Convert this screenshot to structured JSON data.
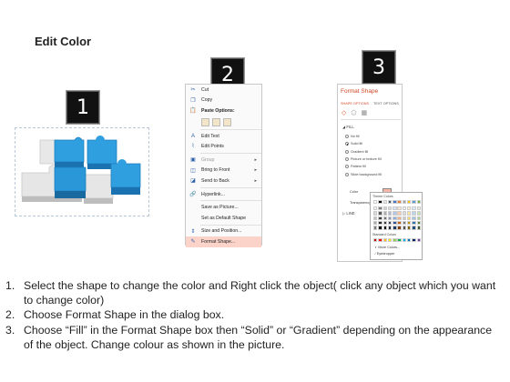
{
  "page": {
    "title": "Edit Color"
  },
  "badges": [
    "1",
    "2",
    "3"
  ],
  "context_menu": {
    "items_top": [
      {
        "label": "Cut",
        "icon": "scissors-icon",
        "glyph": "✂"
      },
      {
        "label": "Copy",
        "icon": "copy-icon",
        "glyph": "❐"
      },
      {
        "label": "Paste Options:",
        "icon": "paste-icon",
        "glyph": "📋"
      }
    ],
    "items": [
      {
        "label": "Edit Text",
        "icon": "edit-text-icon",
        "glyph": "A",
        "dim": false,
        "submenu": false
      },
      {
        "label": "Edit Points",
        "icon": "edit-points-icon",
        "glyph": "⌇",
        "dim": false,
        "submenu": false
      },
      {
        "label": "Group",
        "icon": "group-icon",
        "glyph": "▣",
        "dim": true,
        "submenu": true
      },
      {
        "label": "Bring to Front",
        "icon": "bring-front-icon",
        "glyph": "◫",
        "dim": false,
        "submenu": true
      },
      {
        "label": "Send to Back",
        "icon": "send-back-icon",
        "glyph": "◪",
        "dim": false,
        "submenu": true
      },
      {
        "label": "Hyperlink...",
        "icon": "hyperlink-icon",
        "glyph": "🔗",
        "dim": false,
        "submenu": false
      },
      {
        "label": "Save as Picture...",
        "icon": "",
        "glyph": "",
        "dim": false,
        "submenu": false
      },
      {
        "label": "Set as Default Shape",
        "icon": "",
        "glyph": "",
        "dim": false,
        "submenu": false
      },
      {
        "label": "Size and Position...",
        "icon": "size-position-icon",
        "glyph": "⇕",
        "dim": false,
        "submenu": false
      },
      {
        "label": "Format Shape...",
        "icon": "format-shape-icon",
        "glyph": "✎",
        "dim": false,
        "submenu": false,
        "highlight": true
      }
    ]
  },
  "format_pane": {
    "title": "Format Shape",
    "tabs": [
      "SHAPE OPTIONS",
      "TEXT OPTIONS"
    ],
    "fill_header": "◢ FILL",
    "fill_options": [
      {
        "label": "No fill",
        "selected": false
      },
      {
        "label": "Solid fill",
        "selected": true
      },
      {
        "label": "Gradient fill",
        "selected": false
      },
      {
        "label": "Picture or texture fill",
        "selected": false
      },
      {
        "label": "Pattern fill",
        "selected": false
      },
      {
        "label": "Slide background fill",
        "selected": false
      }
    ],
    "color_label": "Color",
    "transparency_label": "Transparency",
    "line_header": "▷ LINE"
  },
  "color_picker": {
    "theme_label": "Theme Colors",
    "standard_label": "Standard Colors",
    "more_colors": "More Colors...",
    "eyedropper": "Eyedropper",
    "theme_top": [
      "#ffffff",
      "#000000",
      "#e7e6e6",
      "#44546a",
      "#4472c4",
      "#ed7d31",
      "#a5a5a5",
      "#ffc000",
      "#5b9bd5",
      "#70ad47"
    ],
    "theme_shades": [
      "#f2f2f2",
      "#7f7f7f",
      "#d0cece",
      "#d6dce4",
      "#d9e2f3",
      "#fbe5d5",
      "#ededed",
      "#fff2cc",
      "#deebf6",
      "#e2efd9"
    ],
    "theme_shades2": [
      "#d8d8d8",
      "#595959",
      "#aeabab",
      "#adb9ca",
      "#b4c6e7",
      "#f7cbac",
      "#dbdbdb",
      "#fee599",
      "#bdd7ee",
      "#c5e0b3"
    ],
    "theme_shades3": [
      "#bfbfbf",
      "#3f3f3f",
      "#757070",
      "#8496b0",
      "#8eaadb",
      "#f4b183",
      "#c9c9c9",
      "#ffd965",
      "#9cc3e5",
      "#a8d08d"
    ],
    "theme_shades4": [
      "#a5a5a5",
      "#262626",
      "#3a3838",
      "#323f4f",
      "#2f5496",
      "#c55a11",
      "#7b7b7b",
      "#bf9000",
      "#2e75b5",
      "#538135"
    ],
    "theme_shades5": [
      "#7f7f7f",
      "#0c0c0c",
      "#171616",
      "#222a35",
      "#1f3763",
      "#833c0b",
      "#525252",
      "#7f6000",
      "#1e4e79",
      "#375623"
    ],
    "standard": [
      "#c00000",
      "#ff0000",
      "#ffc000",
      "#ffff00",
      "#92d050",
      "#00b050",
      "#00b0f0",
      "#0070c0",
      "#002060",
      "#7030a0"
    ]
  },
  "instructions": [
    {
      "num": "1.",
      "text": "Select the shape to change the color and Right click the object( click any object which you want to change color)"
    },
    {
      "num": "2.",
      "text": "Choose Format Shape in the dialog box."
    },
    {
      "num": "3.",
      "text": "Choose “Fill” in the Format Shape box then “Solid” or “Gradient” depending on the appearance of the object. Change colour as shown in the picture."
    }
  ]
}
